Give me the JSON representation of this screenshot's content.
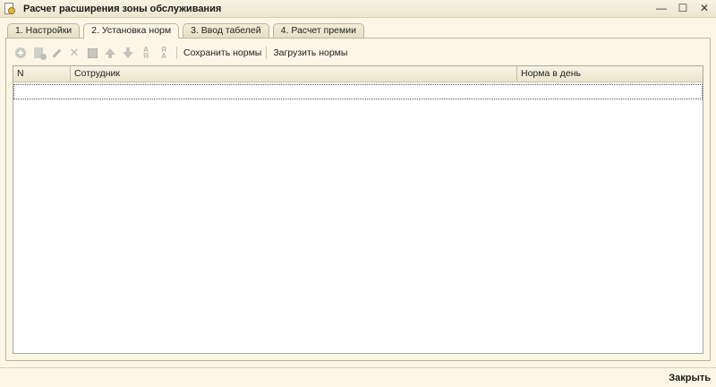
{
  "window": {
    "title": "Расчет расширения зоны обслуживания",
    "minimize_glyph": "—",
    "maximize_glyph": "☐",
    "close_glyph": "✕"
  },
  "tabs": [
    {
      "label": "1. Настройки",
      "active": false
    },
    {
      "label": "2. Установка норм",
      "active": true
    },
    {
      "label": "3. Ввод табелей",
      "active": false
    },
    {
      "label": "4. Расчет премии",
      "active": false
    }
  ],
  "toolbar": {
    "icons": [
      "add-icon",
      "copy-icon",
      "edit-icon",
      "delete-icon",
      "save-icon",
      "move-up-icon",
      "move-down-icon",
      "sort-asc-icon",
      "sort-desc-icon"
    ],
    "save_norms_label": "Сохранить нормы",
    "load_norms_label": "Загрузить нормы"
  },
  "table": {
    "columns": [
      "N",
      "Сотрудник",
      "Норма в день"
    ],
    "rows": []
  },
  "footer": {
    "close_label": "Закрыть"
  }
}
